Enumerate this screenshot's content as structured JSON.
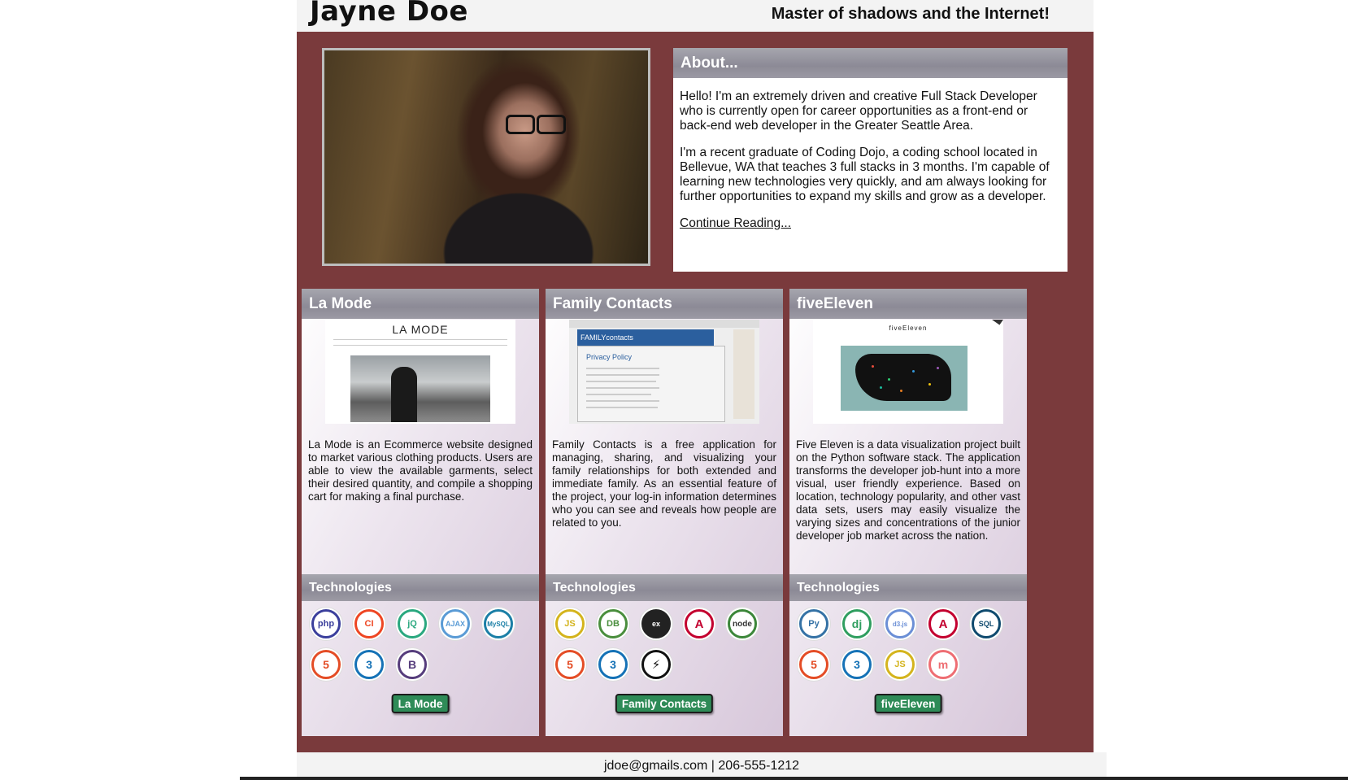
{
  "header": {
    "name": "Jayne Doe",
    "tagline": "Master of shadows and the Internet!"
  },
  "about": {
    "title": "About...",
    "p1": "Hello! I'm an extremely driven and creative Full Stack Developer who is currently open for career opportunities as a front-end or back-end web developer in the Greater Seattle Area.",
    "p2": "I'm a recent graduate of Coding Dojo, a coding school located in Bellevue, WA that teaches 3 full stacks in 3 months. I'm capable of learning new technologies very quickly, and am always looking for further opportunities to expand my skills and grow as a developer.",
    "link": "Continue Reading..."
  },
  "projects": [
    {
      "title": "La Mode",
      "shot_title": "LA MODE",
      "description": "La Mode is an Ecommerce website designed to market various clothing products. Users are able to view the available garments, select their desired quantity, and compile a shopping cart for making a final purchase.",
      "tech_title": "Technologies",
      "button": "La Mode",
      "icons": [
        {
          "name": "php-icon",
          "label": "php",
          "color": "#3b3f9c"
        },
        {
          "name": "codeigniter-icon",
          "label": "CI",
          "color": "#ee4623"
        },
        {
          "name": "jquery-icon",
          "label": "jQ",
          "color": "#2aa87f"
        },
        {
          "name": "ajax-icon",
          "label": "AJAX",
          "color": "#5a9bd5"
        },
        {
          "name": "mysql-icon",
          "label": "MySQL",
          "color": "#1b7fa6"
        },
        {
          "name": "html5-icon",
          "label": "5",
          "color": "#e44d26"
        },
        {
          "name": "css3-icon",
          "label": "3",
          "color": "#1572b6"
        },
        {
          "name": "bootstrap-icon",
          "label": "B",
          "color": "#563d7c"
        }
      ]
    },
    {
      "title": "Family Contacts",
      "shot_title": "FAMILYcontacts",
      "shot_sub": "Privacy Policy",
      "description": "Family Contacts is a free application for managing, sharing, and visualizing your family relationships for both extended and immediate family. As an essential feature of the project, your log-in information determines who you can see and reveals how people are related to you.",
      "tech_title": "Technologies",
      "button": "Family Contacts",
      "icons": [
        {
          "name": "javascript-icon",
          "label": "JS",
          "color": "#d4b41d"
        },
        {
          "name": "mongodb-icon",
          "label": "DB",
          "color": "#4a8e3d"
        },
        {
          "name": "express-icon",
          "label": "ex",
          "color": "#222222"
        },
        {
          "name": "angular-icon",
          "label": "A",
          "color": "#c3002f"
        },
        {
          "name": "node-icon",
          "label": "node",
          "color": "#3c873a"
        },
        {
          "name": "html5-icon",
          "label": "5",
          "color": "#e44d26"
        },
        {
          "name": "css3-icon",
          "label": "3",
          "color": "#1572b6"
        },
        {
          "name": "socketio-icon",
          "label": "⚡",
          "color": "#111111"
        }
      ]
    },
    {
      "title": "fiveEleven",
      "shot_title": "fiveEleven",
      "description": "Five Eleven is a data visualization project built on the Python software stack. The application transforms the developer job-hunt into a more visual, user friendly experience. Based on location, technology popularity, and other vast data sets, users may easily visualize the varying sizes and concentrations of the junior developer job market across the nation.",
      "tech_title": "Technologies",
      "button": "fiveEleven",
      "icons": [
        {
          "name": "python-icon",
          "label": "Py",
          "color": "#3572a5"
        },
        {
          "name": "django-icon",
          "label": "dj",
          "color": "#2f9e5f"
        },
        {
          "name": "d3-icon",
          "label": "d3.js",
          "color": "#6b8fd6"
        },
        {
          "name": "angular-icon",
          "label": "A",
          "color": "#c3002f"
        },
        {
          "name": "sqlite-icon",
          "label": "SQL",
          "color": "#0f4a6e"
        },
        {
          "name": "html5-icon",
          "label": "5",
          "color": "#e44d26"
        },
        {
          "name": "css3-icon",
          "label": "3",
          "color": "#1572b6"
        },
        {
          "name": "javascript-icon",
          "label": "JS",
          "color": "#d4b41d"
        },
        {
          "name": "materialize-icon",
          "label": "m",
          "color": "#ee6e73"
        }
      ]
    }
  ],
  "footer": {
    "contact": "jdoe@gmails.com | 206-555-1212"
  },
  "colors": {
    "frame": "#7a3a3c",
    "button": "#2e8b57",
    "panel_head": "#8c8a96"
  }
}
